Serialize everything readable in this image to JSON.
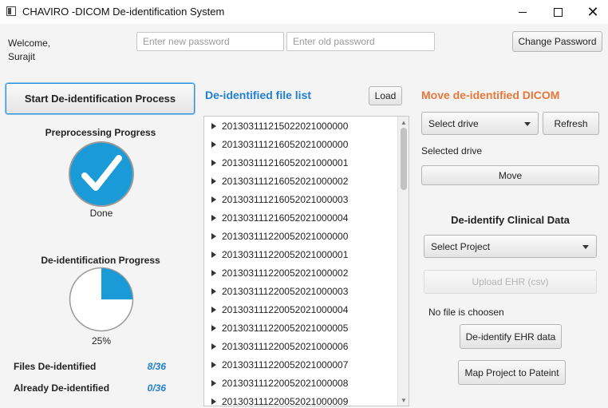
{
  "window": {
    "title": "CHAVIRO -DICOM De-identification System",
    "minimize_icon": "minimize-icon",
    "maximize_icon": "maximize-icon",
    "close_icon": "close-icon"
  },
  "header": {
    "welcome_line1": "Welcome,",
    "welcome_line2": "Surajit",
    "new_password_placeholder": "Enter new password",
    "old_password_placeholder": "Enter old password",
    "change_password_label": "Change Password"
  },
  "left": {
    "start_label": "Start De-identification Process",
    "preprocessing_title": "Preprocessing Progress",
    "preprocessing_status": "Done",
    "preprocessing_icon": "checkmark-icon",
    "deid_title": "De-identification Progress",
    "deid_progress": 0.25,
    "deid_percent_text": "25%",
    "files_deid_label": "Files De-identified",
    "files_deid_value": "8/36",
    "already_deid_label": "Already De-identified",
    "already_deid_value": "0/36",
    "accent_color": "#1a9ad6"
  },
  "middle": {
    "title": "De-identified file list",
    "load_label": "Load",
    "files": [
      "201303111215022021000000",
      "201303111216052021000000",
      "201303111216052021000001",
      "201303111216052021000002",
      "201303111216052021000003",
      "201303111216052021000004",
      "201303111220052021000000",
      "201303111220052021000001",
      "201303111220052021000002",
      "201303111220052021000003",
      "201303111220052021000004",
      "201303111220052021000005",
      "201303111220052021000006",
      "201303111220052021000007",
      "201303111220052021000008",
      "201303111220052021000009"
    ],
    "title_color": "#1f7fd3"
  },
  "right": {
    "move_title": "Move de-identified DICOM",
    "drive_select_value": "Select drive",
    "refresh_label": "Refresh",
    "selected_drive_label": "Selected drive",
    "move_label": "Move",
    "clinical_title": "De-identify Clinical Data",
    "project_select_value": "Select Project",
    "upload_label": "Upload EHR (csv)",
    "no_file_text": "No file is choosen",
    "deid_ehr_label": "De-identify EHR data",
    "map_project_label": "Map Project to Pateint",
    "move_title_color": "#e8773a"
  }
}
